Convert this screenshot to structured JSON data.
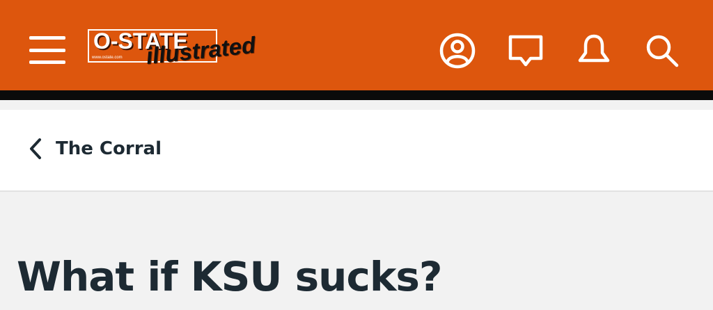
{
  "header": {
    "logo": {
      "main_text": "O-STATE",
      "sub_text": "illustrated",
      "url_text": "www.ostate.com"
    },
    "icons": {
      "menu": "hamburger-icon",
      "profile": "user-circle-icon",
      "chat": "chat-bubble-icon",
      "notifications": "bell-icon",
      "search": "search-icon"
    },
    "colors": {
      "brand": "#dd560d",
      "band": "#0b0b0b"
    }
  },
  "breadcrumb": {
    "back_label": "The Corral"
  },
  "thread": {
    "title": "What if KSU sucks?"
  }
}
